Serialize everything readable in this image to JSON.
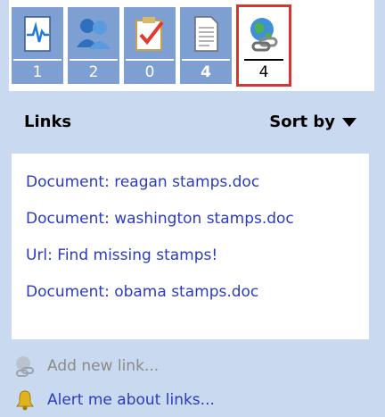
{
  "tabs": [
    {
      "name": "tab-status",
      "icon": "heartbeat-document-icon",
      "count": "1",
      "active": false
    },
    {
      "name": "tab-people",
      "icon": "people-icon",
      "count": "2",
      "active": false
    },
    {
      "name": "tab-tasks",
      "icon": "checklist-icon",
      "count": "0",
      "active": false
    },
    {
      "name": "tab-documents",
      "icon": "document-icon",
      "count": "4",
      "active": false
    },
    {
      "name": "tab-links",
      "icon": "globe-link-icon",
      "count": "4",
      "active": true
    }
  ],
  "header": {
    "title": "Links",
    "sort_label": "Sort by"
  },
  "links": [
    "Document: reagan stamps.doc",
    "Document: washington stamps.doc",
    "Url: Find missing stamps!",
    "Document: obama stamps.doc"
  ],
  "actions": {
    "add_link": "Add new link...",
    "alert": "Alert me about links..."
  }
}
